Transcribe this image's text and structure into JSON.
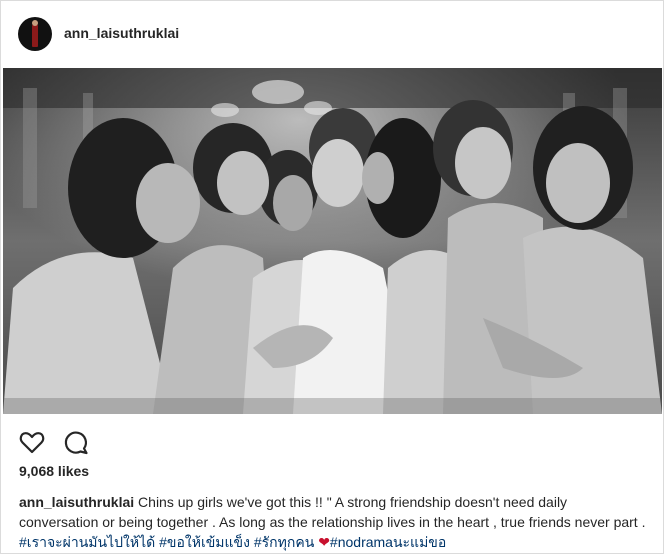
{
  "post": {
    "username": "ann_laisuthruklai",
    "likes": "9,068 likes",
    "caption": {
      "text": "Chins up girls we've got this !! \" A strong friendship doesn't need daily conversation or being together . As long as the relationship lives in the heart , true friends never part .",
      "hashtags": [
        "#เราจะผ่านมันไปให้ได้",
        "#ขอให้เข้มแข็ง",
        "#รักทุกคน",
        "#nodramaนะแม่ขอ"
      ],
      "emoji": "❤"
    }
  },
  "icons": {
    "like": "heart-outline-icon",
    "comment": "comment-bubble-icon"
  },
  "photo": {
    "description_colors": {
      "dark": "#222222",
      "mid": "#8a8a8a",
      "light": "#e6e6e6"
    }
  }
}
